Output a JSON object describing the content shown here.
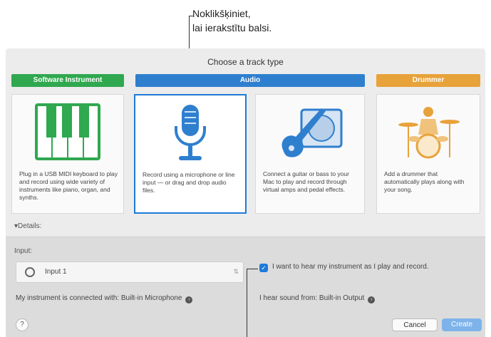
{
  "callout_top": {
    "line1": "Noklikšķiniet,",
    "line2": "lai ierakstītu balsi."
  },
  "window": {
    "title": "Choose a track type",
    "categories": {
      "software": "Software Instrument",
      "audio": "Audio",
      "drummer": "Drummer"
    },
    "cards": [
      {
        "name": "software-instrument",
        "icon": "piano-keyboard-icon",
        "description": "Plug in a USB MIDI keyboard to play and record using wide variety of instruments like piano, organ, and synths.",
        "selected": false
      },
      {
        "name": "audio-microphone",
        "icon": "microphone-icon",
        "description": "Record using a microphone or line input — or drag and drop audio files.",
        "selected": true
      },
      {
        "name": "audio-guitar",
        "icon": "guitar-amp-icon",
        "description": "Connect a guitar or bass to your Mac to play and record through virtual amps and pedal effects.",
        "selected": false
      },
      {
        "name": "drummer",
        "icon": "drummer-icon",
        "description": "Add a drummer that automatically plays along with your song.",
        "selected": false
      }
    ],
    "details_label": "Details:",
    "details_arrow": "▾",
    "input_label": "Input:",
    "input_value": "Input 1",
    "connected_text": "My instrument is connected with: Built-in Microphone",
    "monitor_text": "I want to hear my instrument as I play and record.",
    "monitor_checked": true,
    "hear_text": "I hear sound from: Built-in Output",
    "help_label": "?",
    "cancel_label": "Cancel",
    "create_label": "Create"
  },
  "colors": {
    "software": "#2fa84f",
    "audio": "#2f7fcf",
    "drummer": "#e8a23a",
    "accent": "#1e7ad8"
  }
}
